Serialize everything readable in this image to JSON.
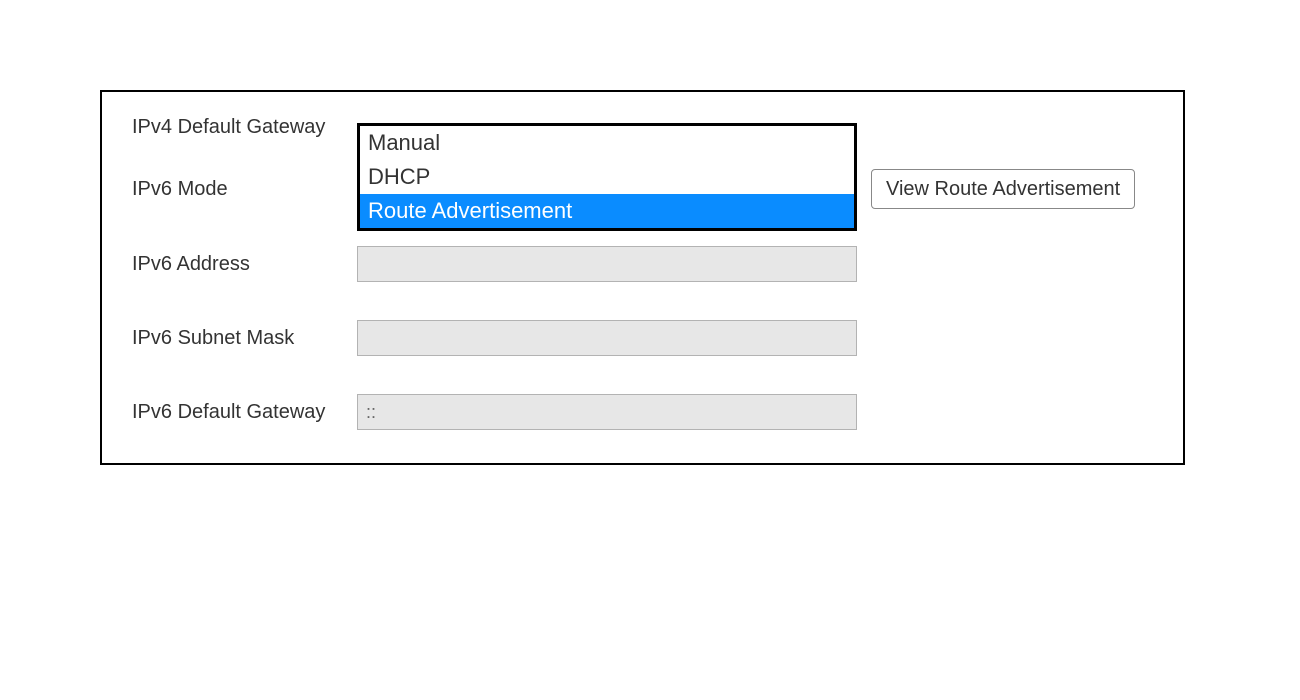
{
  "labels": {
    "ipv4_default_gateway": "IPv4 Default Gateway",
    "ipv6_mode": "IPv6 Mode",
    "ipv6_address": "IPv6 Address",
    "ipv6_subnet_mask": "IPv6 Subnet Mask",
    "ipv6_default_gateway": "IPv6 Default Gateway"
  },
  "ipv6_mode_dropdown": {
    "options": {
      "manual": "Manual",
      "dhcp": "DHCP",
      "route_advertisement": "Route Advertisement"
    },
    "selected": "route_advertisement"
  },
  "buttons": {
    "view_route_advertisement": "View Route Advertisement"
  },
  "fields": {
    "ipv6_address": "",
    "ipv6_subnet_mask": "",
    "ipv6_default_gateway": "::"
  }
}
